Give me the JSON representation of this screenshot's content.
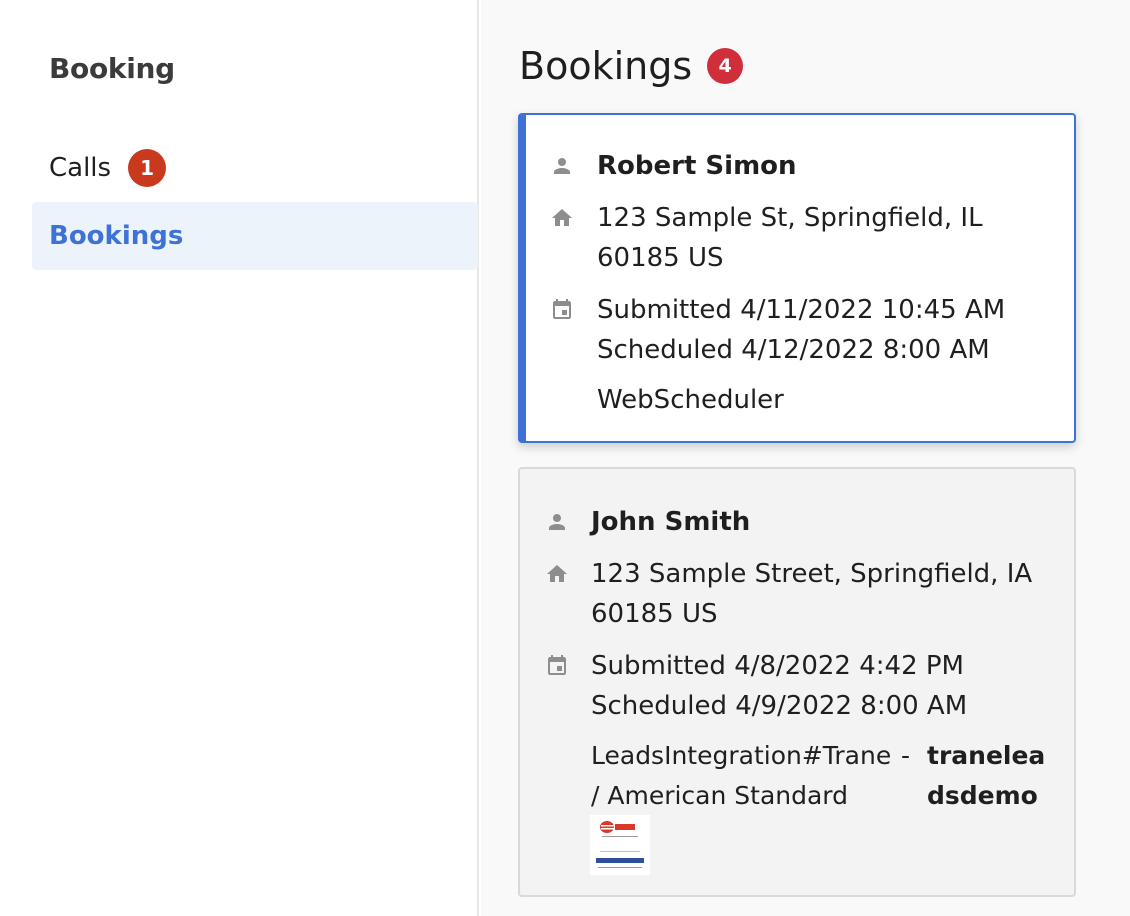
{
  "sidebar": {
    "title": "Booking",
    "items": [
      {
        "label": "Calls",
        "badge": "1"
      },
      {
        "label": "Bookings"
      }
    ]
  },
  "main": {
    "title": "Bookings",
    "badge": "4"
  },
  "bookings": [
    {
      "name": "Robert Simon",
      "address_line1": "123 Sample St, Springfield, IL",
      "address_line2": "60185 US",
      "submitted": "Submitted 4/11/2022 10:45 AM",
      "scheduled": "Scheduled 4/12/2022 8:00 AM",
      "source": "WebScheduler"
    },
    {
      "name": "John Smith",
      "address_line1": "123 Sample Street, Springfield, IA",
      "address_line2": "60185 US",
      "submitted": "Submitted 4/8/2022 4:42 PM",
      "scheduled": "Scheduled 4/9/2022 8:00 AM",
      "source_line1": "LeadsIntegration#Trane",
      "source_line2": "/ American Standard",
      "separator": "-",
      "account_line1": "tranelea",
      "account_line2": "dsdemo",
      "logo_top_text": "TRANE",
      "logo_bottom_text": "American Standard"
    }
  ],
  "colors": {
    "accent": "#3f72d7",
    "badge_red": "#c9391e",
    "selected_bg": "#edf3fb",
    "icon_gray": "#8d8d8d"
  }
}
